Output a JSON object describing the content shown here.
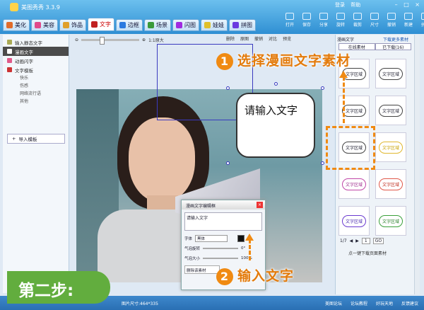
{
  "app": {
    "title": "美图秀秀 3.3.9",
    "links": [
      "登录",
      "帮助"
    ],
    "controls": [
      "–",
      "□",
      "×"
    ]
  },
  "tabs": [
    {
      "label": "美化",
      "color": "#e06b2a",
      "active": false
    },
    {
      "label": "美容",
      "color": "#e04a8a",
      "active": false
    },
    {
      "label": "饰品",
      "color": "#e0a02a",
      "active": false
    },
    {
      "label": "文字",
      "color": "#c02020",
      "active": true
    },
    {
      "label": "边框",
      "color": "#2a7ae0",
      "active": false
    },
    {
      "label": "场景",
      "color": "#3a9a3a",
      "active": false
    },
    {
      "label": "闪图",
      "color": "#a02ae0",
      "active": false
    },
    {
      "label": "娃娃",
      "color": "#e0c02a",
      "active": false
    },
    {
      "label": "拼图",
      "color": "#6a3ae0",
      "active": false
    }
  ],
  "toolbar": [
    "打开",
    "保存",
    "分享",
    "旋转",
    "裁剪",
    "尺寸",
    "撤销",
    "新建",
    "拼图"
  ],
  "left_panel": {
    "items": [
      {
        "label": "输入静态文字",
        "selected": false
      },
      {
        "label": "漫画文字",
        "selected": true
      },
      {
        "label": "动画闪字",
        "selected": false
      },
      {
        "label": "文字模板",
        "selected": false
      }
    ],
    "sub_items": [
      "快乐",
      "伤感",
      "网络流行语",
      "其他"
    ],
    "import_button": "导入模板"
  },
  "edit_bar": {
    "zoom_label": "1:1原大",
    "actions": [
      "删除",
      "原图",
      "撤销",
      "对比",
      "预览"
    ]
  },
  "bubble": {
    "text": "请输入文字"
  },
  "dialog": {
    "title": "漫画文字编辑框",
    "textarea": "请输入文字",
    "font_label": "字体",
    "font_value": "黑体",
    "rotate_label": "气泡旋转",
    "rotate_value": "0°",
    "size_label": "气泡大小",
    "size_value": "100%",
    "delete_label": "删除该素材"
  },
  "status": {
    "size": "图片尺寸:464*335",
    "items": [
      "美图论坛",
      "论坛教程",
      "好玩天地",
      "反馈建议"
    ]
  },
  "right_panel": {
    "tabs": [
      "漫画文字",
      "下载更多素材"
    ],
    "sub_tabs": [
      "在线素材",
      "已下载(16)"
    ],
    "thumb_label": "文字区域",
    "pager": {
      "current": "1/7",
      "page": "1",
      "go": "GO"
    },
    "note": "点一键下载页面素材"
  },
  "annotations": {
    "step1_num": "1",
    "step1_text": "选择漫画文字素材",
    "step2_num": "2",
    "step2_text": "输入文字",
    "step_badge": "第二步:"
  }
}
